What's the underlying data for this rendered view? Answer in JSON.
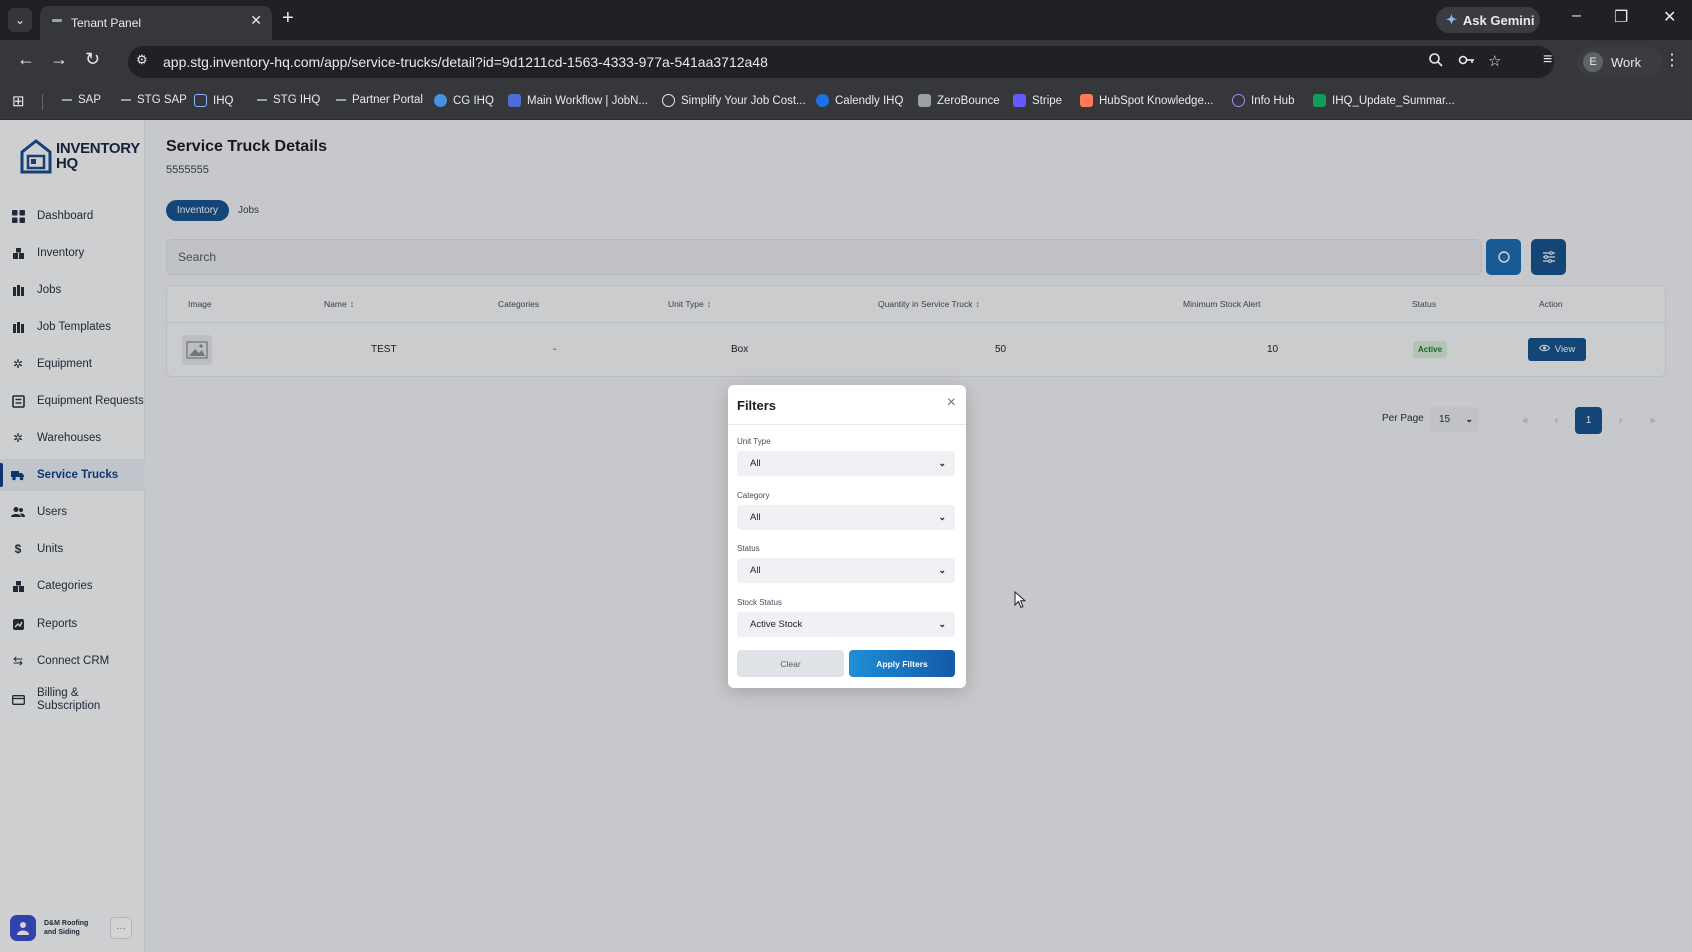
{
  "browser": {
    "tab_title": "Tenant Panel",
    "gemini_label": "Ask Gemini",
    "url": "app.stg.inventory-hq.com/app/service-trucks/detail?id=9d1211cd-1563-4333-977a-541aa3712a48",
    "profile_initial": "E",
    "profile_label": "Work",
    "bookmarks": [
      "SAP",
      "STG SAP",
      "IHQ",
      "STG IHQ",
      "Partner Portal",
      "CG IHQ",
      "Main Workflow | JobN...",
      "Simplify Your Job Cost...",
      "Calendly IHQ",
      "ZeroBounce",
      "Stripe",
      "HubSpot Knowledge...",
      "Info Hub",
      "IHQ_Update_Summar..."
    ]
  },
  "sidebar": {
    "logo_line1": "INVENTORY",
    "logo_line2": "HQ",
    "items": [
      {
        "label": "Dashboard",
        "icon": "grid-icon"
      },
      {
        "label": "Inventory",
        "icon": "boxes-icon"
      },
      {
        "label": "Jobs",
        "icon": "jobs-icon"
      },
      {
        "label": "Job Templates",
        "icon": "templates-icon"
      },
      {
        "label": "Equipment",
        "icon": "wrench-icon"
      },
      {
        "label": "Equipment Requests",
        "icon": "list-icon"
      },
      {
        "label": "Warehouses",
        "icon": "warehouse-icon"
      },
      {
        "label": "Service Trucks",
        "icon": "truck-icon"
      },
      {
        "label": "Users",
        "icon": "users-icon"
      },
      {
        "label": "Units",
        "icon": "units-icon"
      },
      {
        "label": "Categories",
        "icon": "categories-icon"
      },
      {
        "label": "Reports",
        "icon": "reports-icon"
      },
      {
        "label": "Connect CRM",
        "icon": "crm-icon"
      },
      {
        "label": "Billing & Subscription",
        "icon": "card-icon"
      }
    ],
    "active_item": "Service Trucks",
    "account_name": "D&M Roofing and Siding"
  },
  "page": {
    "title": "Service Truck Details",
    "subtitle": "5555555",
    "tabs": [
      "Inventory",
      "Jobs"
    ],
    "active_tab": "Inventory",
    "search_placeholder": "Search"
  },
  "table": {
    "headers": [
      "Image",
      "Name",
      "Categories",
      "Unit Type",
      "Quantity in Service Truck",
      "Minimum Stock Alert",
      "Status",
      "Action"
    ],
    "rows": [
      {
        "name": "TEST",
        "categories": "-",
        "unit_type": "Box",
        "quantity": "50",
        "min_stock": "10",
        "status": "Active",
        "action": "View"
      }
    ]
  },
  "pagination": {
    "per_page_label": "Per Page",
    "per_page_value": "15",
    "first": "«",
    "prev": "‹",
    "current": "1",
    "next": "›",
    "last": "»"
  },
  "filters_modal": {
    "title": "Filters",
    "close_glyph": "×",
    "fields": [
      {
        "label": "Unit Type",
        "value": "All"
      },
      {
        "label": "Category",
        "value": "All"
      },
      {
        "label": "Status",
        "value": "All"
      },
      {
        "label": "Stock Status",
        "value": "Active Stock"
      }
    ],
    "clear_label": "Clear",
    "apply_label": "Apply Filters"
  },
  "colors": {
    "primary": "#17558f",
    "status_active_bg": "#d7ecd9",
    "status_active_text": "#1f7a3a"
  }
}
